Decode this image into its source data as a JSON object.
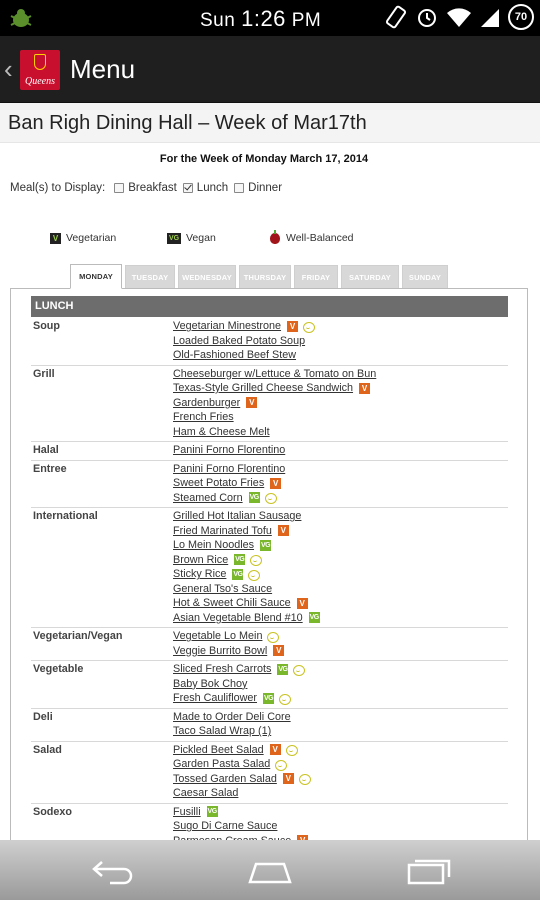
{
  "status_bar": {
    "clock_prefix": "Sun",
    "clock_time": "1:26",
    "clock_ampm": "PM",
    "battery": "70"
  },
  "action_bar": {
    "logo_text": "Queens",
    "title": "Menu"
  },
  "page": {
    "heading": "Ban Righ Dining Hall – Week of Mar17th",
    "week_line": "For the Week of Monday March 17, 2014"
  },
  "meal_filter": {
    "label": "Meal(s) to Display:",
    "options": [
      {
        "label": "Breakfast",
        "checked": false
      },
      {
        "label": "Lunch",
        "checked": true
      },
      {
        "label": "Dinner",
        "checked": false
      }
    ]
  },
  "legend": {
    "vegetarian": {
      "badge": "V",
      "label": "Vegetarian"
    },
    "vegan": {
      "badge": "VG",
      "label": "Vegan"
    },
    "well_balanced": {
      "label": "Well-Balanced"
    }
  },
  "tabs": [
    "MONDAY",
    "TUESDAY",
    "WEDNESDAY",
    "THURSDAY",
    "FRIDAY",
    "SATURDAY",
    "SUNDAY"
  ],
  "active_tab": "MONDAY",
  "meal_section": "LUNCH",
  "badge_labels": {
    "V": "V",
    "VG": "VG"
  },
  "colors": {
    "vegetarian_badge": "#e0651c",
    "vegan_badge": "#7ab72c",
    "well_balanced_icon": "#c9c323",
    "section_bar": "#6d6d6d",
    "brand_red": "#c8102e"
  },
  "menu": [
    {
      "category": "Soup",
      "items": [
        {
          "name": "Vegetarian Minestrone",
          "tags": [
            "V",
            "W"
          ]
        },
        {
          "name": "Loaded Baked Potato Soup",
          "tags": []
        },
        {
          "name": "Old-Fashioned Beef Stew",
          "tags": []
        }
      ]
    },
    {
      "category": "Grill",
      "items": [
        {
          "name": "Cheeseburger w/Lettuce & Tomato on Bun",
          "tags": []
        },
        {
          "name": "Texas-Style Grilled Cheese Sandwich",
          "tags": [
            "V"
          ]
        },
        {
          "name": "Gardenburger",
          "tags": [
            "V"
          ]
        },
        {
          "name": "French Fries",
          "tags": []
        },
        {
          "name": "Ham & Cheese Melt",
          "tags": []
        }
      ]
    },
    {
      "category": "Halal",
      "items": [
        {
          "name": "Panini Forno Florentino",
          "tags": []
        }
      ]
    },
    {
      "category": "Entree",
      "items": [
        {
          "name": "Panini Forno Florentino",
          "tags": []
        },
        {
          "name": "Sweet Potato Fries",
          "tags": [
            "V"
          ]
        },
        {
          "name": "Steamed Corn",
          "tags": [
            "VG",
            "W"
          ]
        }
      ]
    },
    {
      "category": "International",
      "items": [
        {
          "name": "Grilled Hot Italian Sausage",
          "tags": []
        },
        {
          "name": "Fried Marinated Tofu",
          "tags": [
            "V"
          ]
        },
        {
          "name": "Lo Mein Noodles",
          "tags": [
            "VG"
          ]
        },
        {
          "name": "Brown Rice",
          "tags": [
            "VG",
            "W"
          ]
        },
        {
          "name": "Sticky Rice",
          "tags": [
            "VG",
            "W"
          ]
        },
        {
          "name": "General Tso's Sauce",
          "tags": []
        },
        {
          "name": "Hot & Sweet Chili Sauce",
          "tags": [
            "V"
          ]
        },
        {
          "name": "Asian Vegetable Blend #10",
          "tags": [
            "VG"
          ]
        }
      ]
    },
    {
      "category": "Vegetarian/Vegan",
      "items": [
        {
          "name": "Vegetable Lo Mein",
          "tags": [
            "W"
          ]
        },
        {
          "name": "Veggie Burrito Bowl",
          "tags": [
            "V"
          ]
        }
      ]
    },
    {
      "category": "Vegetable",
      "items": [
        {
          "name": "Sliced Fresh Carrots",
          "tags": [
            "VG",
            "W"
          ]
        },
        {
          "name": "Baby Bok Choy",
          "tags": []
        },
        {
          "name": "Fresh Cauliflower",
          "tags": [
            "VG",
            "W"
          ]
        }
      ]
    },
    {
      "category": "Deli",
      "items": [
        {
          "name": "Made to Order Deli Core",
          "tags": []
        },
        {
          "name": "Taco Salad Wrap (1)",
          "tags": []
        }
      ]
    },
    {
      "category": "Salad",
      "items": [
        {
          "name": "Pickled Beet Salad",
          "tags": [
            "V",
            "W"
          ]
        },
        {
          "name": "Garden Pasta Salad",
          "tags": [
            "W"
          ]
        },
        {
          "name": "Tossed Garden Salad",
          "tags": [
            "V",
            "W"
          ]
        },
        {
          "name": "Caesar Salad",
          "tags": []
        }
      ]
    },
    {
      "category": "Sodexo",
      "items": [
        {
          "name": "Fusilli",
          "tags": [
            "VG"
          ]
        },
        {
          "name": "Sugo Di Carne Sauce",
          "tags": []
        },
        {
          "name": "Parmesan Cream Sauce",
          "tags": [
            "V"
          ]
        }
      ]
    }
  ]
}
